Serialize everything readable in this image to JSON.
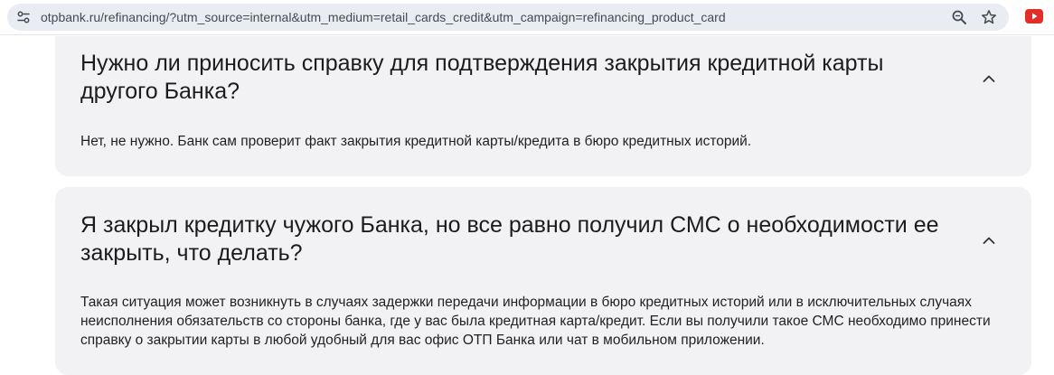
{
  "browser": {
    "url": "otpbank.ru/refinancing/?utm_source=internal&utm_medium=retail_cards_credit&utm_campaign=refinancing_product_card",
    "icons": [
      "site-info-icon",
      "zoom-icon",
      "star-icon",
      "youtube-extension-icon"
    ],
    "accent": "#e52d27"
  },
  "faq": [
    {
      "question": "Нужно ли приносить справку для подтверждения закрытия кредитной карты другого Банка?",
      "answer": "Нет, не нужно. Банк сам проверит факт закрытия кредитной карты/кредита в бюро кредитных историй.",
      "expanded": true
    },
    {
      "question": "Я закрыл кредитку чужого Банка, но все равно получил СМС о необходимости ее закрыть, что делать?",
      "answer": "Такая ситуация может возникнуть в случаях задержки передачи информации в бюро кредитных историй или в исключительных случаях неисполнения обязательств со стороны банка, где у вас была кредитная карта/кредит. Если вы получили такое СМС необходимо принести справку о закрытии карты в любой удобный для вас офис ОТП Банка или чат в мобильном приложении.",
      "expanded": true
    }
  ],
  "colors": {
    "card_background": "#f2f2f4",
    "omnibox_background": "#e9edf3"
  }
}
